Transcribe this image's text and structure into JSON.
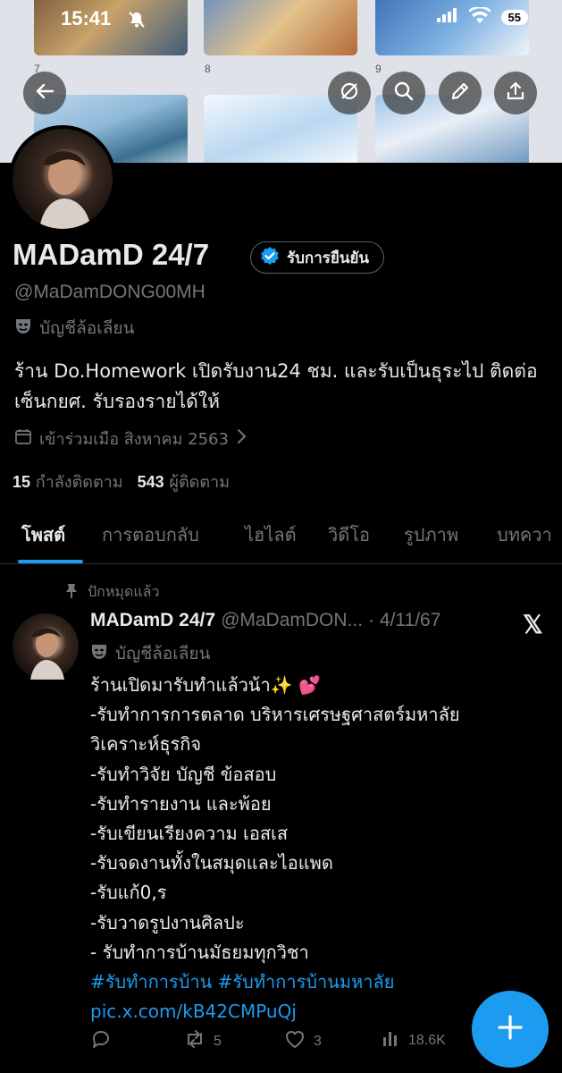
{
  "status_bar": {
    "time": "15:41",
    "battery": "55"
  },
  "banner": {
    "page_numbers": [
      "7",
      "8",
      "9"
    ]
  },
  "toolbar": {
    "icons": [
      "back-arrow-icon",
      "grok-icon",
      "search-icon",
      "edit-icon",
      "share-icon"
    ]
  },
  "profile": {
    "name": "MADamD 24/7",
    "verified_label": "รับการยืนยัน",
    "handle": "@MaDamDONG00MH",
    "parody_label": "บัญชีล้อเลียน",
    "bio": "ร้าน Do.Homework เปิดรับงาน24 ชม. และรับเป็นธุระไป ติดต่อเซ็นกยศ. รับรองรายได้ให้",
    "joined": "เข้าร่วมเมือ สิงหาคม 2563",
    "following_count": "15",
    "following_label": "กำลังติดตาม",
    "followers_count": "543",
    "followers_label": "ผู้ติดตาม"
  },
  "tabs": [
    "โพสต์",
    "การตอบกลับ",
    "ไฮไลต์",
    "วิดีโอ",
    "รูปภาพ",
    "บทควา"
  ],
  "post": {
    "pinned_label": "ปักหมุดแล้ว",
    "author_name": "MADamD 24/7",
    "author_handle": "@MaDamDON...",
    "date": "· 4/11/67",
    "parody_label": "บัญชีล้อเลียน",
    "lines": [
      "ร้านเปิดมารับทำแล้วน้า✨ 💕",
      "-รับทำการการตลาด บริหารเศรษฐศาสตร์มหาลัย",
      "วิเคราะห์ธุรกิจ",
      "-รับทำวิจัย บัญชี ข้อสอบ",
      "-รับทำรายงาน และพ้อย",
      "-รับเขียนเรียงความ เอสเส",
      "-รับจดงานทั้งในสมุดและไอแพด",
      "-รับแก้0,ร",
      "-รับวาดรูปงานศิลปะ",
      "- รับทำการบ้านมัธยมทุกวิชา"
    ],
    "hashtags": "#รับทำการบ้าน #รับทำการบ้านมหาลัย",
    "link": "pic.x.com/kB42CMPuQj",
    "replies": "",
    "reposts": "5",
    "likes": "3",
    "views": "18.6K"
  },
  "colors": {
    "accent": "#1d9bf0",
    "background": "#000000",
    "muted": "#71767b",
    "text": "#e7e9ea"
  }
}
